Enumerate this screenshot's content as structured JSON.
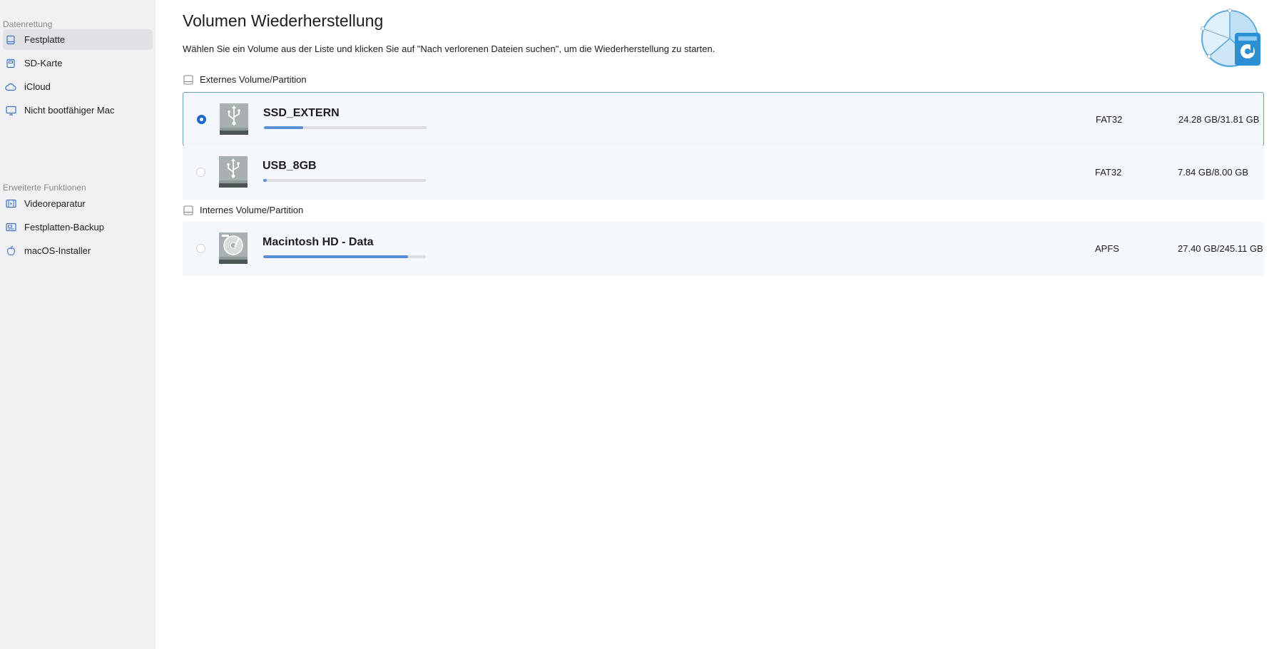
{
  "sidebar": {
    "section_recovery": "Datenrettung",
    "section_advanced": "Erweiterte Funktionen",
    "items": [
      {
        "label": "Festplatte",
        "icon": "hard-drive-icon",
        "active": true
      },
      {
        "label": "SD-Karte",
        "icon": "sd-card-icon",
        "active": false
      },
      {
        "label": "iCloud",
        "icon": "cloud-icon",
        "active": false
      },
      {
        "label": "Nicht bootfähiger Mac",
        "icon": "monitor-icon",
        "active": false
      }
    ],
    "advanced_items": [
      {
        "label": "Videoreparatur",
        "icon": "film-icon"
      },
      {
        "label": "Festplatten-Backup",
        "icon": "backup-icon"
      },
      {
        "label": "macOS-Installer",
        "icon": "apple-icon"
      }
    ]
  },
  "main": {
    "title": "Volumen Wiederherstellung",
    "subtitle": "Wählen Sie ein Volume aus der Liste und klicken Sie auf \"Nach verlorenen Dateien suchen\", um die Wiederherstellung zu starten.",
    "external_group": "Externes Volume/Partition",
    "internal_group": "Internes Volume/Partition",
    "volumes": [
      {
        "name": "SSD_EXTERN",
        "fs": "FAT32",
        "size": "24.28 GB/31.81 GB",
        "usage_fraction": 0.24,
        "selected": true,
        "type": "usb-drive-icon"
      },
      {
        "name": "USB_8GB",
        "fs": "FAT32",
        "size": "7.84 GB/8.00 GB",
        "usage_fraction": 0.02,
        "selected": false,
        "type": "usb-drive-icon"
      },
      {
        "name": "Macintosh HD - Data",
        "fs": "APFS",
        "size": "27.40 GB/245.11 GB",
        "usage_fraction": 0.89,
        "selected": false,
        "type": "internal-disk-icon"
      }
    ]
  },
  "colors": {
    "accent": "#1a66d2",
    "usage_bar": "#5a8fd6",
    "selected_border": "#6b9dbd",
    "row_background": "#f4f7fb",
    "sidebar_background": "#f1f1f3"
  }
}
